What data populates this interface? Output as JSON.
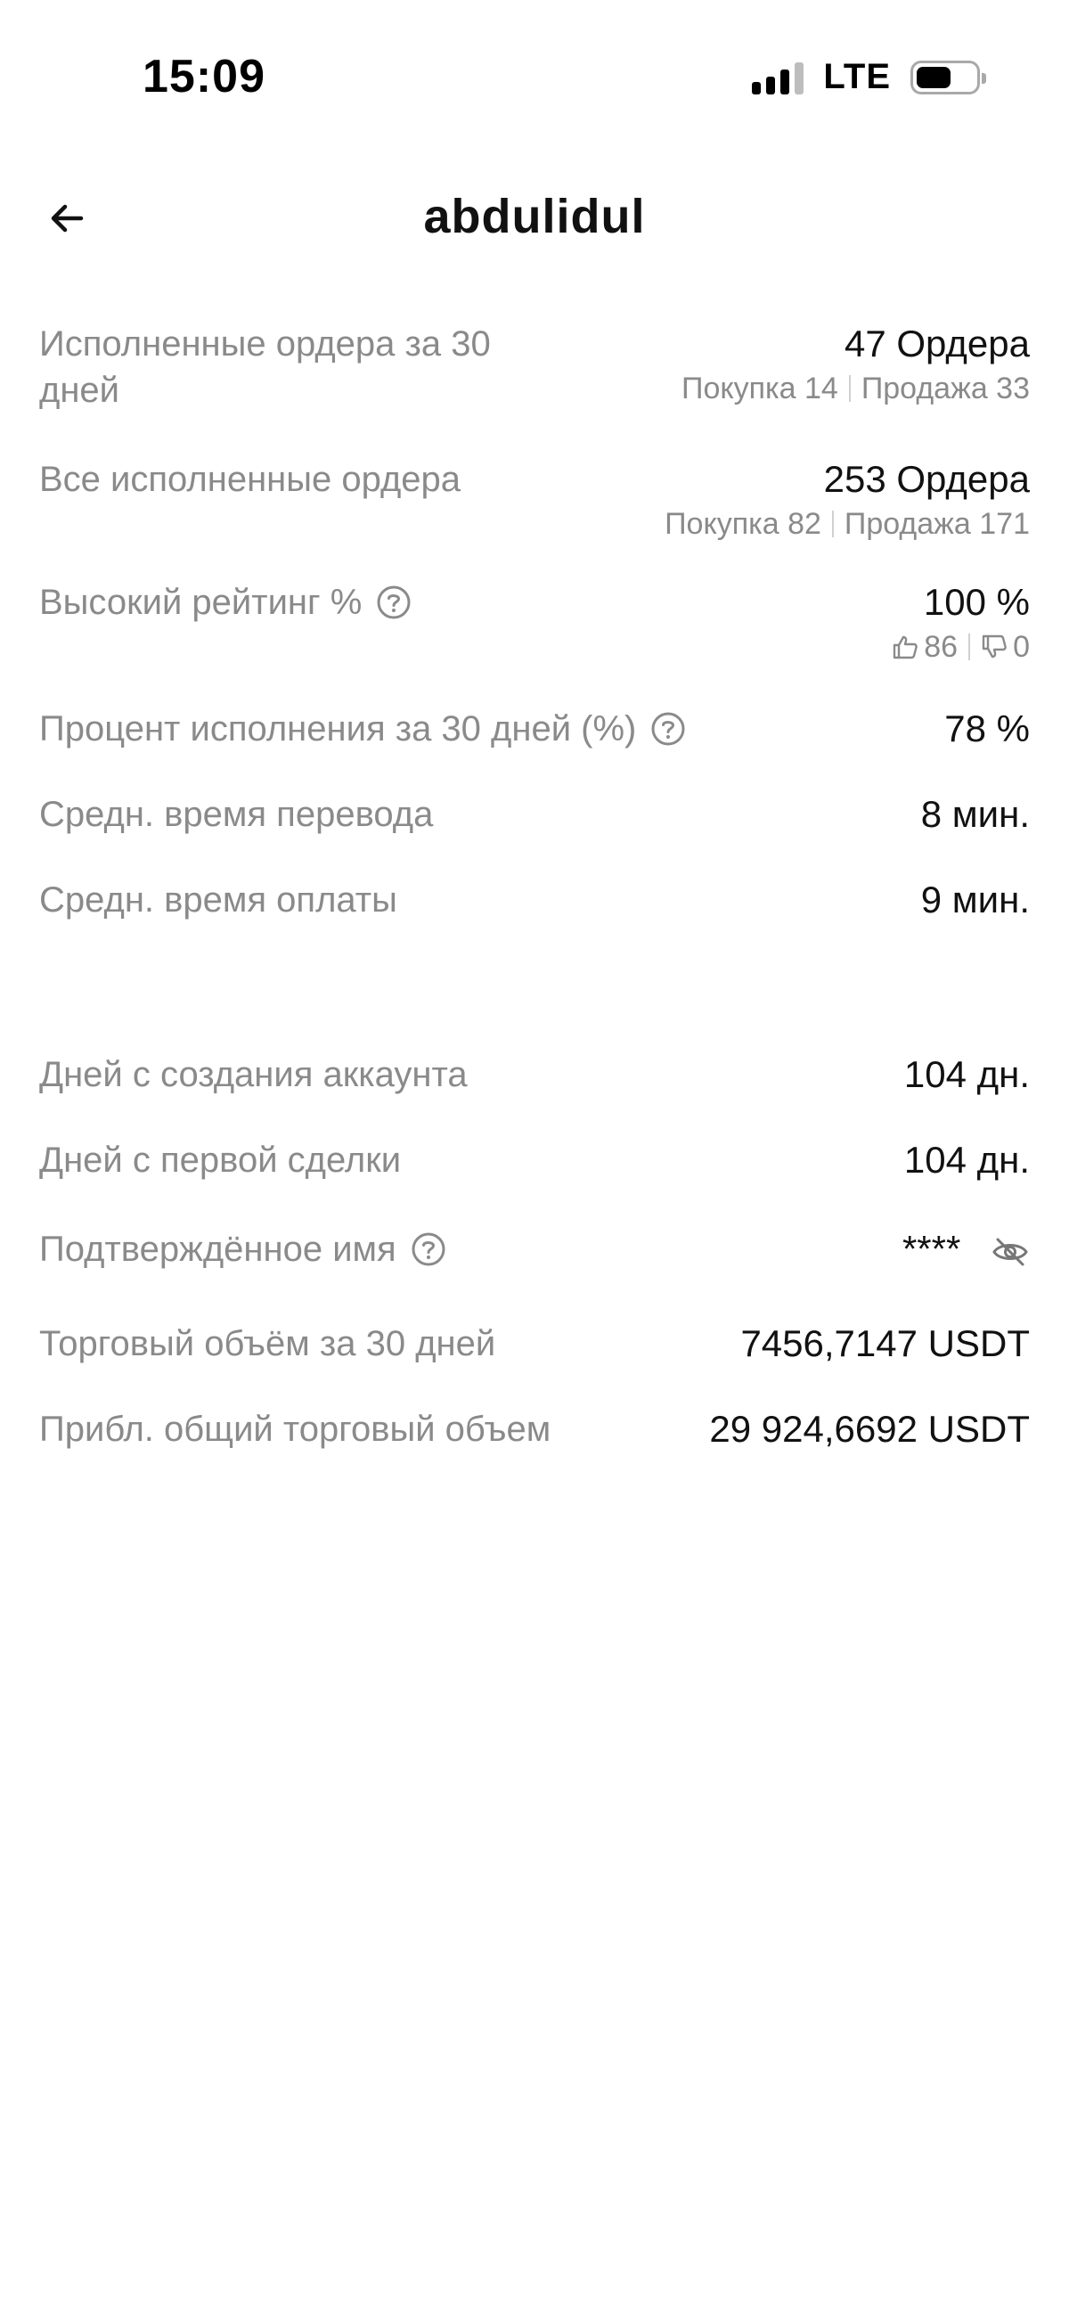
{
  "status_bar": {
    "time": "15:09",
    "network": "LTE",
    "battery_level": 0.6
  },
  "header": {
    "back_icon": "arrow-left-icon",
    "title": "abdulidul"
  },
  "stats": {
    "completed_30d": {
      "label": "Исполненные ордера за 30 дней",
      "value": "47 Ордера",
      "buy": "Покупка 14",
      "sell": "Продажа 33"
    },
    "completed_all": {
      "label": "Все исполненные ордера",
      "value": "253 Ордера",
      "buy": "Покупка 82",
      "sell": "Продажа 171"
    },
    "rating": {
      "label": "Высокий рейтинг %",
      "value": "100 %",
      "likes": "86",
      "dislikes": "0"
    },
    "completion_rate": {
      "label": "Процент исполнения за 30 дней (%)",
      "value": "78 %"
    },
    "avg_transfer": {
      "label": "Средн. время перевода",
      "value": "8 мин."
    },
    "avg_payment": {
      "label": "Средн. время оплаты",
      "value": "9 мин."
    },
    "account_age": {
      "label": "Дней с создания аккаунта",
      "value": "104 дн."
    },
    "first_trade": {
      "label": "Дней с первой сделки",
      "value": "104 дн."
    },
    "verified_name": {
      "label": "Подтверждённое имя",
      "value": "****"
    },
    "volume_30d": {
      "label": "Торговый объём за 30 дней",
      "value": "7456,7147 USDT"
    },
    "volume_total": {
      "label": "Прибл. общий торговый объем",
      "value": "29 924,6692 USDT"
    }
  },
  "colors": {
    "label": "#8a8a8a",
    "value": "#111111",
    "background": "#ffffff"
  }
}
